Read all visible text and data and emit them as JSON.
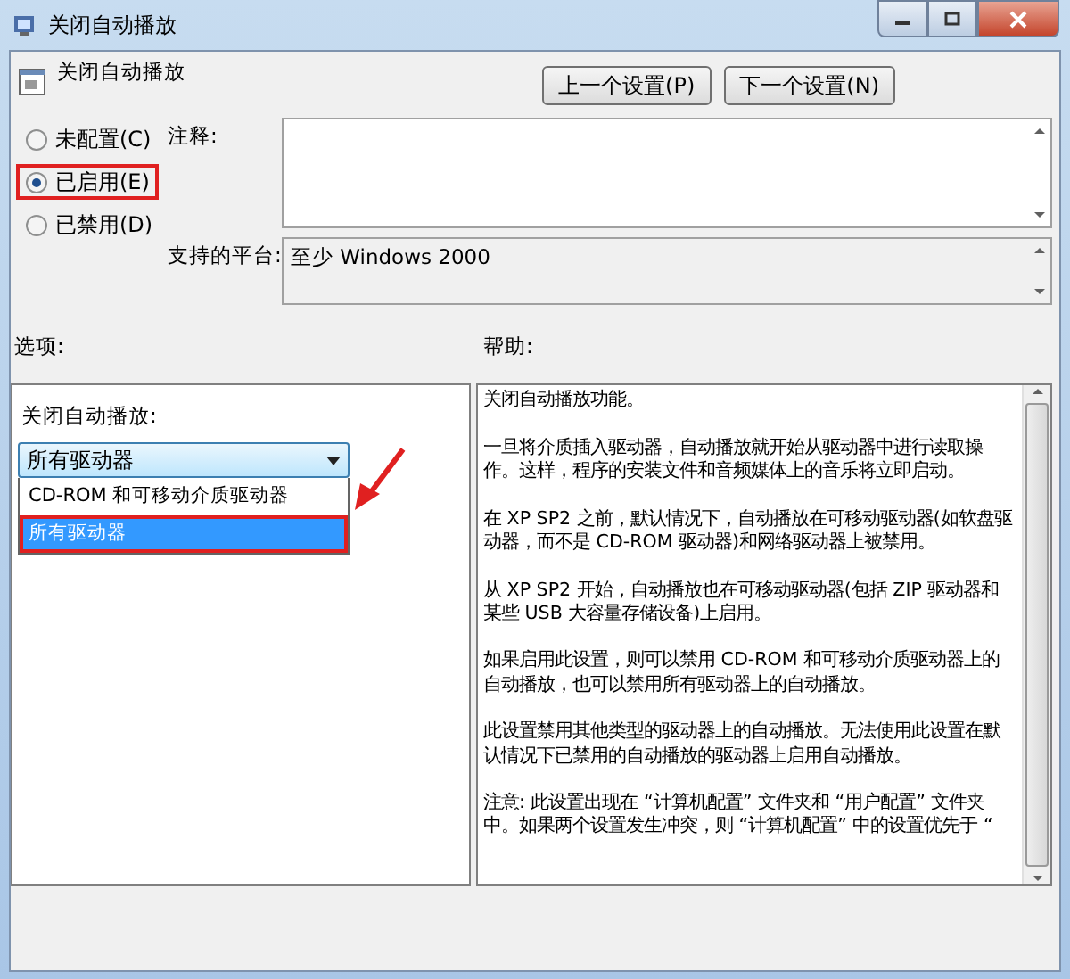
{
  "window": {
    "title": "关闭自动播放"
  },
  "header": {
    "title": "关闭自动播放",
    "buttons": [
      "上一个设置(P)",
      "下一个设置(N)"
    ]
  },
  "radios": [
    {
      "label": "未配置(C)",
      "selected": false,
      "highlighted": false
    },
    {
      "label": "已启用(E)",
      "selected": true,
      "highlighted": true
    },
    {
      "label": "已禁用(D)",
      "selected": false,
      "highlighted": false
    }
  ],
  "comment": {
    "label": "注释:"
  },
  "platform": {
    "label": "支持的平台:",
    "value": "至少 Windows 2000"
  },
  "options": {
    "label": "选项:",
    "setting_label": "关闭自动播放:",
    "dropdown": {
      "value": "所有驱动器",
      "expanded": true,
      "items": [
        {
          "label": "CD-ROM 和可移动介质驱动器",
          "selected": false,
          "highlighted": false
        },
        {
          "label": "所有驱动器",
          "selected": true,
          "highlighted": true
        }
      ]
    },
    "annotation_arrow": true
  },
  "help": {
    "label": "帮助:",
    "paragraphs": [
      "关闭自动播放功能。",
      "一旦将介质插入驱动器，自动播放就开始从驱动器中进行读取操作。这样，程序的安装文件和音频媒体上的音乐将立即启动。",
      "在 XP SP2 之前，默认情况下，自动播放在可移动驱动器(如软盘驱动器，而不是 CD-ROM 驱动器)和网络驱动器上被禁用。",
      "从 XP SP2 开始，自动播放也在可移动驱动器(包括 ZIP 驱动器和某些 USB 大容量存储设备)上启用。",
      "如果启用此设置，则可以禁用 CD-ROM 和可移动介质驱动器上的自动播放，也可以禁用所有驱动器上的自动播放。",
      "此设置禁用其他类型的驱动器上的自动播放。无法使用此设置在默认情况下已禁用的自动播放的驱动器上启用自动播放。",
      "注意: 此设置出现在 “计算机配置” 文件夹和 “用户配置” 文件夹中。如果两个设置发生冲突，则 “计算机配置” 中的设置优先于 “"
    ]
  }
}
